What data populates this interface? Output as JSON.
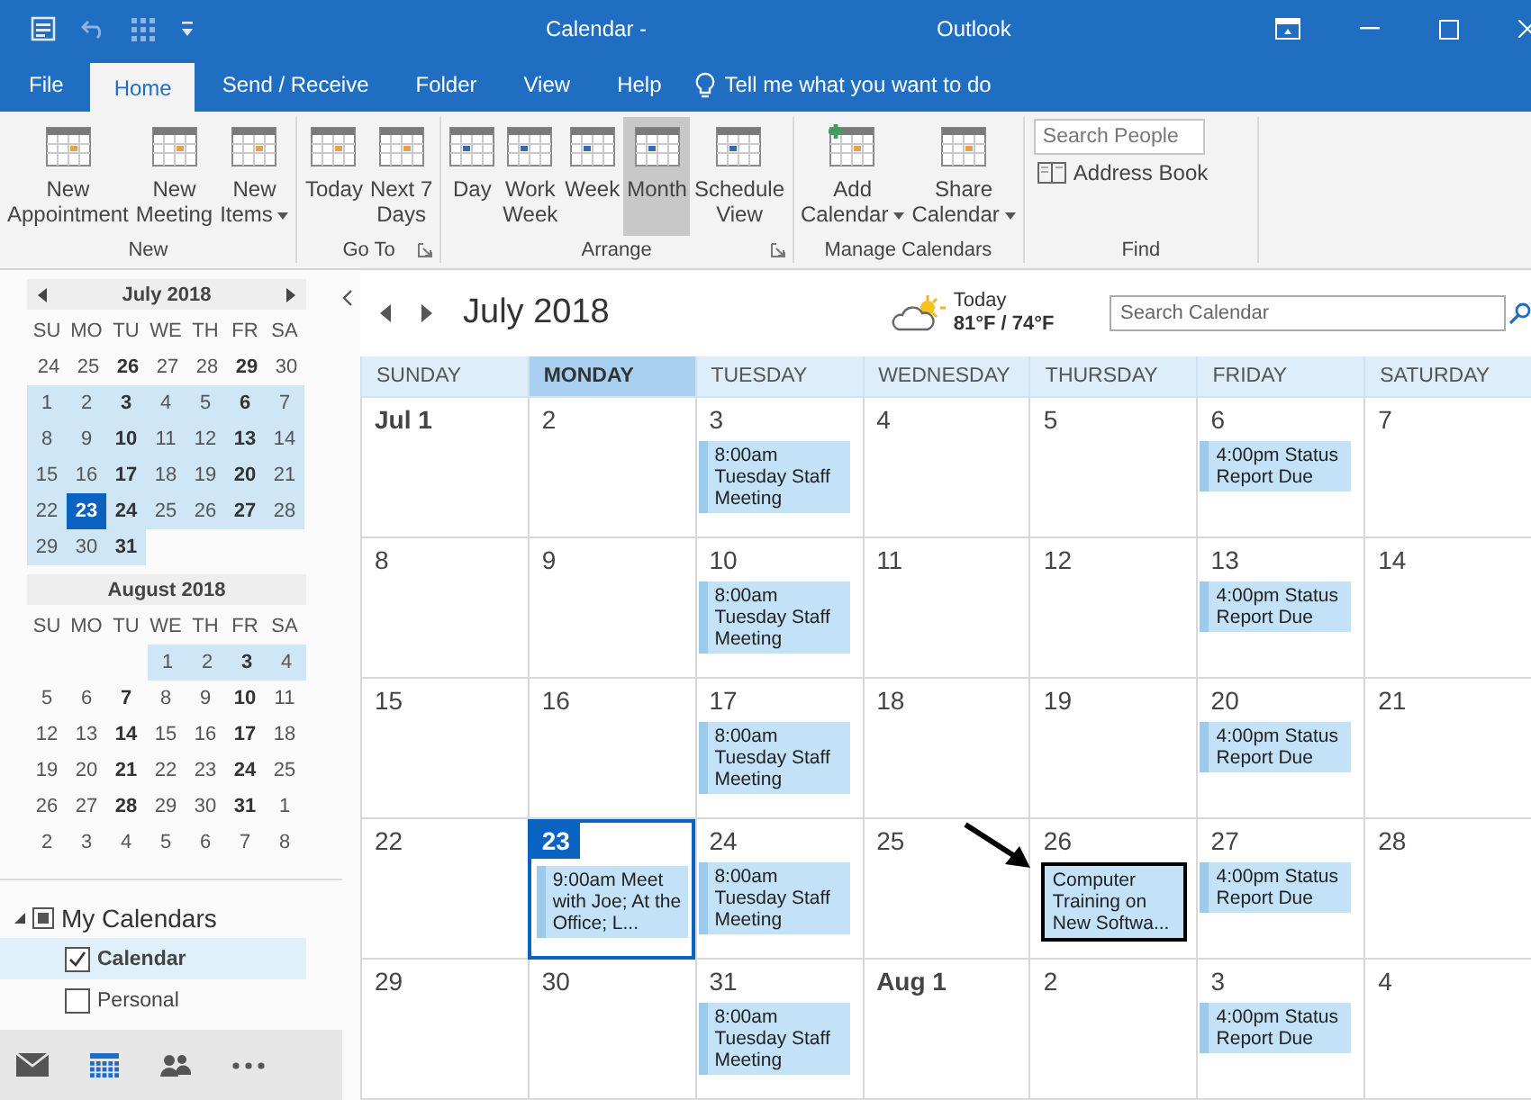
{
  "window": {
    "title": "Calendar -",
    "app": "Outlook"
  },
  "menu_tabs": [
    {
      "label": "File",
      "selected": false
    },
    {
      "label": "Home",
      "selected": true
    },
    {
      "label": "Send / Receive",
      "selected": false
    },
    {
      "label": "Folder",
      "selected": false
    },
    {
      "label": "View",
      "selected": false
    },
    {
      "label": "Help",
      "selected": false
    }
  ],
  "tell_me": "Tell me what you want to do",
  "ribbon": [
    {
      "label": "New",
      "launcher": false,
      "buttons": [
        {
          "lines": [
            "New",
            "Appointment"
          ],
          "dropdown": false,
          "selected": false
        },
        {
          "lines": [
            "New",
            "Meeting"
          ],
          "dropdown": false,
          "selected": false
        },
        {
          "lines": [
            "New",
            "Items"
          ],
          "dropdown": true,
          "selected": false
        }
      ]
    },
    {
      "label": "Go To",
      "launcher": true,
      "buttons": [
        {
          "lines": [
            "Today"
          ],
          "dropdown": false,
          "selected": false
        },
        {
          "lines": [
            "Next 7",
            "Days"
          ],
          "dropdown": false,
          "selected": false
        }
      ]
    },
    {
      "label": "Arrange",
      "launcher": true,
      "buttons": [
        {
          "lines": [
            "Day"
          ],
          "dropdown": false,
          "selected": false
        },
        {
          "lines": [
            "Work",
            "Week"
          ],
          "dropdown": false,
          "selected": false
        },
        {
          "lines": [
            "Week"
          ],
          "dropdown": false,
          "selected": false
        },
        {
          "lines": [
            "Month"
          ],
          "dropdown": false,
          "selected": true
        },
        {
          "lines": [
            "Schedule",
            "View"
          ],
          "dropdown": false,
          "selected": false
        }
      ]
    },
    {
      "label": "Manage Calendars",
      "launcher": false,
      "buttons": [
        {
          "lines": [
            "Add",
            "Calendar"
          ],
          "dropdown": true,
          "selected": false
        },
        {
          "lines": [
            "Share",
            "Calendar"
          ],
          "dropdown": true,
          "selected": false
        }
      ]
    }
  ],
  "find": {
    "label": "Find",
    "search": {
      "placeholder": "Search People"
    },
    "address_book": "Address Book"
  },
  "mini_calendars": [
    {
      "title": "July 2018",
      "weekdays": [
        "SU",
        "MO",
        "TU",
        "WE",
        "TH",
        "FR",
        "SA"
      ],
      "days": [
        {
          "d": "24",
          "bold": false,
          "in_view": false,
          "selected": false
        },
        {
          "d": "25",
          "bold": false,
          "in_view": false,
          "selected": false
        },
        {
          "d": "26",
          "bold": true,
          "in_view": false,
          "selected": false
        },
        {
          "d": "27",
          "bold": false,
          "in_view": false,
          "selected": false
        },
        {
          "d": "28",
          "bold": false,
          "in_view": false,
          "selected": false
        },
        {
          "d": "29",
          "bold": true,
          "in_view": false,
          "selected": false
        },
        {
          "d": "30",
          "bold": false,
          "in_view": false,
          "selected": false
        },
        {
          "d": "1",
          "bold": false,
          "in_view": true,
          "selected": false
        },
        {
          "d": "2",
          "bold": false,
          "in_view": true,
          "selected": false
        },
        {
          "d": "3",
          "bold": true,
          "in_view": true,
          "selected": false
        },
        {
          "d": "4",
          "bold": false,
          "in_view": true,
          "selected": false
        },
        {
          "d": "5",
          "bold": false,
          "in_view": true,
          "selected": false
        },
        {
          "d": "6",
          "bold": true,
          "in_view": true,
          "selected": false
        },
        {
          "d": "7",
          "bold": false,
          "in_view": true,
          "selected": false
        },
        {
          "d": "8",
          "bold": false,
          "in_view": true,
          "selected": false
        },
        {
          "d": "9",
          "bold": false,
          "in_view": true,
          "selected": false
        },
        {
          "d": "10",
          "bold": true,
          "in_view": true,
          "selected": false
        },
        {
          "d": "11",
          "bold": false,
          "in_view": true,
          "selected": false
        },
        {
          "d": "12",
          "bold": false,
          "in_view": true,
          "selected": false
        },
        {
          "d": "13",
          "bold": true,
          "in_view": true,
          "selected": false
        },
        {
          "d": "14",
          "bold": false,
          "in_view": true,
          "selected": false
        },
        {
          "d": "15",
          "bold": false,
          "in_view": true,
          "selected": false
        },
        {
          "d": "16",
          "bold": false,
          "in_view": true,
          "selected": false
        },
        {
          "d": "17",
          "bold": true,
          "in_view": true,
          "selected": false
        },
        {
          "d": "18",
          "bold": false,
          "in_view": true,
          "selected": false
        },
        {
          "d": "19",
          "bold": false,
          "in_view": true,
          "selected": false
        },
        {
          "d": "20",
          "bold": true,
          "in_view": true,
          "selected": false
        },
        {
          "d": "21",
          "bold": false,
          "in_view": true,
          "selected": false
        },
        {
          "d": "22",
          "bold": false,
          "in_view": true,
          "selected": false
        },
        {
          "d": "23",
          "bold": true,
          "in_view": true,
          "selected": true
        },
        {
          "d": "24",
          "bold": true,
          "in_view": true,
          "selected": false
        },
        {
          "d": "25",
          "bold": false,
          "in_view": true,
          "selected": false
        },
        {
          "d": "26",
          "bold": false,
          "in_view": true,
          "selected": false
        },
        {
          "d": "27",
          "bold": true,
          "in_view": true,
          "selected": false
        },
        {
          "d": "28",
          "bold": false,
          "in_view": true,
          "selected": false
        },
        {
          "d": "29",
          "bold": false,
          "in_view": true,
          "selected": false
        },
        {
          "d": "30",
          "bold": false,
          "in_view": true,
          "selected": false
        },
        {
          "d": "31",
          "bold": true,
          "in_view": true,
          "selected": false
        }
      ]
    },
    {
      "title": "August 2018",
      "weekdays": [
        "SU",
        "MO",
        "TU",
        "WE",
        "TH",
        "FR",
        "SA"
      ],
      "days": [
        {
          "d": "1",
          "bold": false,
          "in_view": true,
          "selected": false
        },
        {
          "d": "2",
          "bold": false,
          "in_view": true,
          "selected": false
        },
        {
          "d": "3",
          "bold": true,
          "in_view": true,
          "selected": false
        },
        {
          "d": "4",
          "bold": false,
          "in_view": true,
          "selected": false
        },
        {
          "d": "5",
          "bold": false,
          "in_view": false,
          "selected": false
        },
        {
          "d": "6",
          "bold": false,
          "in_view": false,
          "selected": false
        },
        {
          "d": "7",
          "bold": true,
          "in_view": false,
          "selected": false
        },
        {
          "d": "8",
          "bold": false,
          "in_view": false,
          "selected": false
        },
        {
          "d": "9",
          "bold": false,
          "in_view": false,
          "selected": false
        },
        {
          "d": "10",
          "bold": true,
          "in_view": false,
          "selected": false
        },
        {
          "d": "11",
          "bold": false,
          "in_view": false,
          "selected": false
        },
        {
          "d": "12",
          "bold": false,
          "in_view": false,
          "selected": false
        },
        {
          "d": "13",
          "bold": false,
          "in_view": false,
          "selected": false
        },
        {
          "d": "14",
          "bold": true,
          "in_view": false,
          "selected": false
        },
        {
          "d": "15",
          "bold": false,
          "in_view": false,
          "selected": false
        },
        {
          "d": "16",
          "bold": false,
          "in_view": false,
          "selected": false
        },
        {
          "d": "17",
          "bold": true,
          "in_view": false,
          "selected": false
        },
        {
          "d": "18",
          "bold": false,
          "in_view": false,
          "selected": false
        },
        {
          "d": "19",
          "bold": false,
          "in_view": false,
          "selected": false
        },
        {
          "d": "20",
          "bold": false,
          "in_view": false,
          "selected": false
        },
        {
          "d": "21",
          "bold": true,
          "in_view": false,
          "selected": false
        },
        {
          "d": "22",
          "bold": false,
          "in_view": false,
          "selected": false
        },
        {
          "d": "23",
          "bold": false,
          "in_view": false,
          "selected": false
        },
        {
          "d": "24",
          "bold": true,
          "in_view": false,
          "selected": false
        },
        {
          "d": "25",
          "bold": false,
          "in_view": false,
          "selected": false
        },
        {
          "d": "26",
          "bold": false,
          "in_view": false,
          "selected": false
        },
        {
          "d": "27",
          "bold": false,
          "in_view": false,
          "selected": false
        },
        {
          "d": "28",
          "bold": true,
          "in_view": false,
          "selected": false
        },
        {
          "d": "29",
          "bold": false,
          "in_view": false,
          "selected": false
        },
        {
          "d": "30",
          "bold": false,
          "in_view": false,
          "selected": false
        },
        {
          "d": "31",
          "bold": true,
          "in_view": false,
          "selected": false
        },
        {
          "d": "1",
          "bold": false,
          "in_view": false,
          "selected": false
        },
        {
          "d": "2",
          "bold": false,
          "in_view": false,
          "selected": false
        },
        {
          "d": "3",
          "bold": false,
          "in_view": false,
          "selected": false
        },
        {
          "d": "4",
          "bold": false,
          "in_view": false,
          "selected": false
        },
        {
          "d": "5",
          "bold": false,
          "in_view": false,
          "selected": false
        },
        {
          "d": "6",
          "bold": false,
          "in_view": false,
          "selected": false
        },
        {
          "d": "7",
          "bold": false,
          "in_view": false,
          "selected": false
        },
        {
          "d": "8",
          "bold": false,
          "in_view": false,
          "selected": false
        }
      ]
    }
  ],
  "folders": {
    "label": "My Calendars",
    "expanded": true,
    "children": [
      {
        "label": "Calendar",
        "checked": true,
        "selected": true
      },
      {
        "label": "Personal",
        "checked": false,
        "selected": false
      }
    ]
  },
  "nav": [
    {
      "kind": "mail",
      "selected": false
    },
    {
      "kind": "calendar",
      "selected": true
    },
    {
      "kind": "people",
      "selected": false
    },
    {
      "kind": "more",
      "selected": false
    }
  ],
  "calendar": {
    "title": "July 2018",
    "weather": {
      "label": "Today",
      "temps": "81°F / 74°F"
    },
    "search": {
      "placeholder": "Search Calendar"
    },
    "weekdays": [
      {
        "label": "SUNDAY",
        "selected": false
      },
      {
        "label": "MONDAY",
        "selected": true
      },
      {
        "label": "TUESDAY",
        "selected": false
      },
      {
        "label": "WEDNESDAY",
        "selected": false
      },
      {
        "label": "THURSDAY",
        "selected": false
      },
      {
        "label": "FRIDAY",
        "selected": false
      },
      {
        "label": "SATURDAY",
        "selected": false
      }
    ],
    "weeks": [
      [
        {
          "date": "Jul 1",
          "bold": true,
          "today": false
        },
        {
          "date": "2",
          "bold": false,
          "today": false
        },
        {
          "date": "3",
          "bold": false,
          "today": false,
          "events": [
            {
              "text": "8:00am Tuesday Staff Meeting",
              "highlighted": false
            }
          ]
        },
        {
          "date": "4",
          "bold": false,
          "today": false
        },
        {
          "date": "5",
          "bold": false,
          "today": false
        },
        {
          "date": "6",
          "bold": false,
          "today": false,
          "events": [
            {
              "text": "4:00pm Status Report Due",
              "highlighted": false
            }
          ]
        },
        {
          "date": "7",
          "bold": false,
          "today": false
        }
      ],
      [
        {
          "date": "8",
          "bold": false,
          "today": false
        },
        {
          "date": "9",
          "bold": false,
          "today": false
        },
        {
          "date": "10",
          "bold": false,
          "today": false,
          "events": [
            {
              "text": "8:00am Tuesday Staff Meeting",
              "highlighted": false
            }
          ]
        },
        {
          "date": "11",
          "bold": false,
          "today": false
        },
        {
          "date": "12",
          "bold": false,
          "today": false
        },
        {
          "date": "13",
          "bold": false,
          "today": false,
          "events": [
            {
              "text": "4:00pm Status Report Due",
              "highlighted": false
            }
          ]
        },
        {
          "date": "14",
          "bold": false,
          "today": false
        }
      ],
      [
        {
          "date": "15",
          "bold": false,
          "today": false
        },
        {
          "date": "16",
          "bold": false,
          "today": false
        },
        {
          "date": "17",
          "bold": false,
          "today": false,
          "events": [
            {
              "text": "8:00am Tuesday Staff Meeting",
              "highlighted": false
            }
          ]
        },
        {
          "date": "18",
          "bold": false,
          "today": false
        },
        {
          "date": "19",
          "bold": false,
          "today": false
        },
        {
          "date": "20",
          "bold": false,
          "today": false,
          "events": [
            {
              "text": "4:00pm Status Report Due",
              "highlighted": false
            }
          ]
        },
        {
          "date": "21",
          "bold": false,
          "today": false
        }
      ],
      [
        {
          "date": "22",
          "bold": false,
          "today": false
        },
        {
          "date": "23",
          "bold": false,
          "today": true,
          "events": [
            {
              "text": "9:00am Meet with Joe; At the Office; L...",
              "highlighted": false
            }
          ]
        },
        {
          "date": "24",
          "bold": false,
          "today": false,
          "events": [
            {
              "text": "8:00am Tuesday Staff Meeting",
              "highlighted": false
            }
          ]
        },
        {
          "date": "25",
          "bold": false,
          "today": false
        },
        {
          "date": "26",
          "bold": false,
          "today": false,
          "events": [
            {
              "text": "Computer Training on New Softwa...",
              "highlighted": true
            }
          ]
        },
        {
          "date": "27",
          "bold": false,
          "today": false,
          "events": [
            {
              "text": "4:00pm Status Report Due",
              "highlighted": false
            }
          ]
        },
        {
          "date": "28",
          "bold": false,
          "today": false
        }
      ],
      [
        {
          "date": "29",
          "bold": false,
          "today": false
        },
        {
          "date": "30",
          "bold": false,
          "today": false
        },
        {
          "date": "31",
          "bold": false,
          "today": false,
          "events": [
            {
              "text": "8:00am Tuesday Staff Meeting",
              "highlighted": false
            }
          ]
        },
        {
          "date": "Aug 1",
          "bold": true,
          "today": false
        },
        {
          "date": "2",
          "bold": false,
          "today": false
        },
        {
          "date": "3",
          "bold": false,
          "today": false,
          "events": [
            {
              "text": "4:00pm Status Report Due",
              "highlighted": false
            }
          ]
        },
        {
          "date": "4",
          "bold": false,
          "today": false
        }
      ]
    ]
  }
}
